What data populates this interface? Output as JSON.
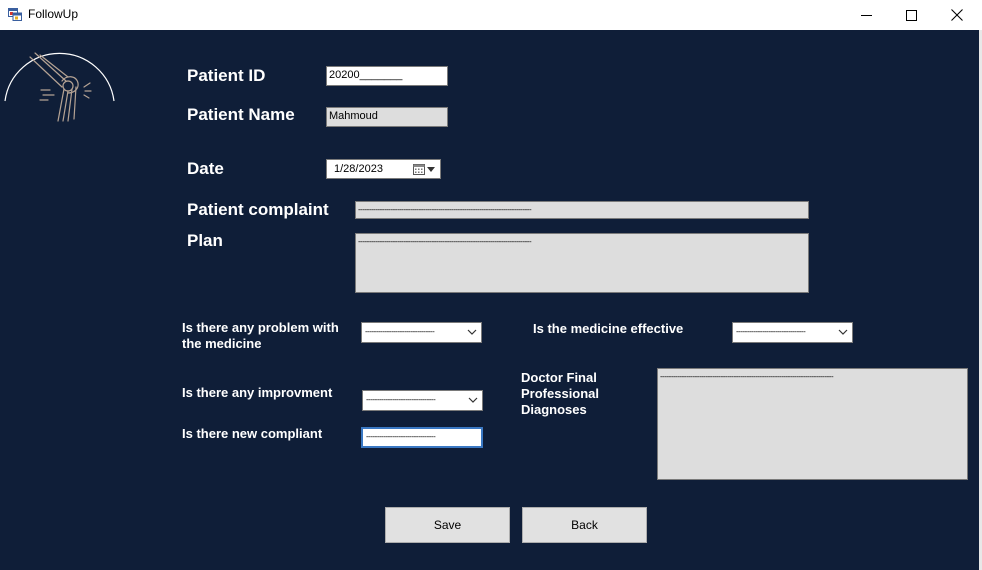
{
  "window": {
    "title": "FollowUp",
    "minimize_icon": "minimize-icon",
    "maximize_icon": "maximize-icon",
    "close_icon": "close-icon"
  },
  "colors": {
    "background": "#0f1e38",
    "label": "#ffffff",
    "field_grey": "#dddddd",
    "button": "#e1e1e1"
  },
  "logo": {
    "icon": "knee-joint-logo-icon"
  },
  "form": {
    "patient_id": {
      "label": "Patient ID",
      "value": "20200_______"
    },
    "patient_name": {
      "label": "Patient Name",
      "value": "Mahmoud"
    },
    "date": {
      "label": "Date",
      "value": "1/28/2023",
      "calendar_icon": "calendar-icon"
    },
    "complaint": {
      "label": "Patient complaint",
      "value": "--------------------------------------------------------------------------------"
    },
    "plan": {
      "label": "Plan",
      "value": "--------------------------------------------------------------------------------"
    },
    "medicine_problem": {
      "label_line1": "Is there any problem with",
      "label_line2": "the medicine",
      "value": "--------------------------------"
    },
    "medicine_effective": {
      "label": "Is the medicine effective",
      "value": "--------------------------------"
    },
    "improvement": {
      "label": "Is there any improvment",
      "value": "--------------------------------"
    },
    "new_complaint": {
      "label": "Is there new compliant",
      "value": "--------------------------------"
    },
    "diagnoses": {
      "label_line1": "Doctor Final",
      "label_line2": "Professional",
      "label_line3": "Diagnoses",
      "value": "--------------------------------------------------------------------------------"
    }
  },
  "buttons": {
    "save": "Save",
    "back": "Back"
  }
}
